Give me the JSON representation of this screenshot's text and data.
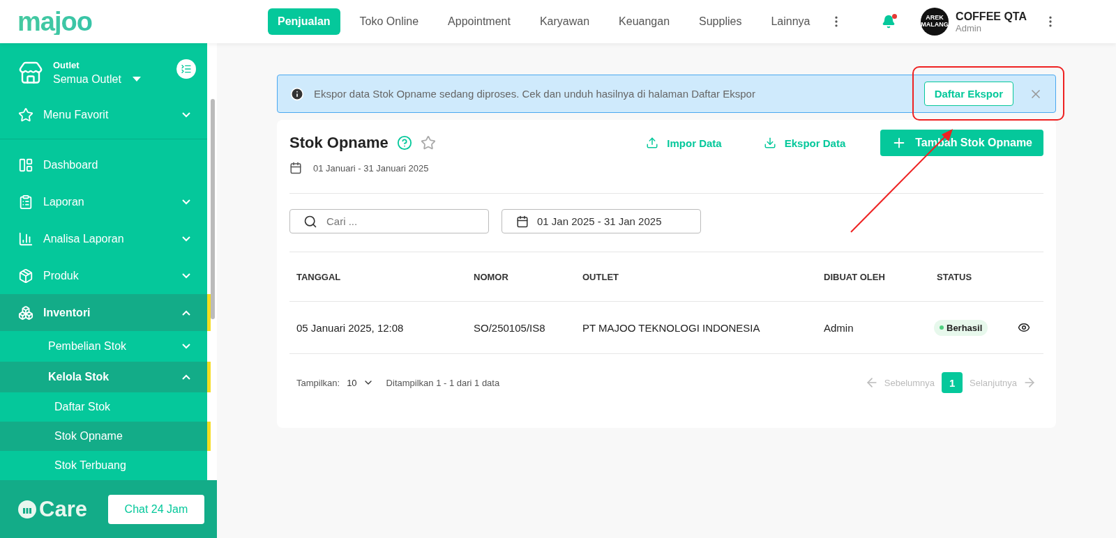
{
  "top_bar": {
    "logo": "majoo",
    "tabs": [
      {
        "label": "Penjualan",
        "selected": true
      },
      {
        "label": "Toko Online",
        "selected": false
      },
      {
        "label": "Appointment",
        "selected": false
      },
      {
        "label": "Karyawan",
        "selected": false
      },
      {
        "label": "Keuangan",
        "selected": false
      },
      {
        "label": "Supplies",
        "selected": false
      },
      {
        "label": "Lainnya",
        "selected": false
      }
    ],
    "notification": {
      "unread": true
    },
    "account": {
      "avatar_text": [
        "AREK",
        "MALANG"
      ],
      "name": "COFFEE QTA",
      "role": "Admin"
    }
  },
  "sidebar": {
    "outlet": {
      "label": "Outlet",
      "value": "Semua Outlet"
    },
    "favorites": {
      "label": "Menu Favorit",
      "expanded": false
    },
    "items": [
      {
        "label": "Dashboard",
        "selected": false
      },
      {
        "label": "Laporan",
        "expanded": false,
        "selected": false
      },
      {
        "label": "Analisa Laporan",
        "expanded": false,
        "selected": false
      },
      {
        "label": "Produk",
        "expanded": false,
        "selected": false
      },
      {
        "label": "Inventori",
        "expanded": true,
        "selected": true,
        "children": [
          {
            "label": "Pembelian Stok",
            "expanded": false,
            "selected": false
          },
          {
            "label": "Kelola Stok",
            "expanded": true,
            "selected": true,
            "children": [
              {
                "label": "Daftar Stok",
                "selected": false
              },
              {
                "label": "Stok Opname",
                "selected": true
              },
              {
                "label": "Stok Terbuang",
                "selected": false
              }
            ]
          }
        ]
      }
    ],
    "footer": {
      "brand": "Care",
      "button": "Chat 24 Jam"
    }
  },
  "banner": {
    "message": "Ekspor data Stok Opname sedang diproses. Cek dan unduh hasilnya di halaman Daftar Ekspor",
    "button": "Daftar Ekspor"
  },
  "page": {
    "title": "Stok Opname",
    "period": "01 Januari - 31 Januari 2025",
    "actions": [
      {
        "kind": "import",
        "label": "Impor Data"
      },
      {
        "kind": "export",
        "label": "Ekspor Data"
      },
      {
        "kind": "add",
        "label": "Tambah Stok Opname"
      }
    ],
    "search": {
      "placeholder": "Cari ..."
    },
    "date_range": "01 Jan 2025 - 31 Jan 2025"
  },
  "table": {
    "columns": [
      "TANGGAL",
      "NOMOR",
      "OUTLET",
      "DIBUAT OLEH",
      "STATUS"
    ],
    "rows": [
      {
        "date": "05 Januari 2025, 12:08",
        "number": "SO/250105/IS8",
        "outlet": "PT MAJOO TEKNOLOGI INDONESIA",
        "created_by": "Admin",
        "status": {
          "label": "Berhasil",
          "color": "#4fd07f"
        }
      }
    ]
  },
  "footer": {
    "per_page_label": "Tampilkan:",
    "per_page": "10",
    "summary": "Ditampilkan 1 - 1 dari 1 data",
    "prev": {
      "label": "Sebelumnya",
      "disabled": true
    },
    "pages": [
      {
        "label": "1",
        "selected": true
      }
    ],
    "next": {
      "label": "Selanjutnya",
      "disabled": true
    }
  }
}
